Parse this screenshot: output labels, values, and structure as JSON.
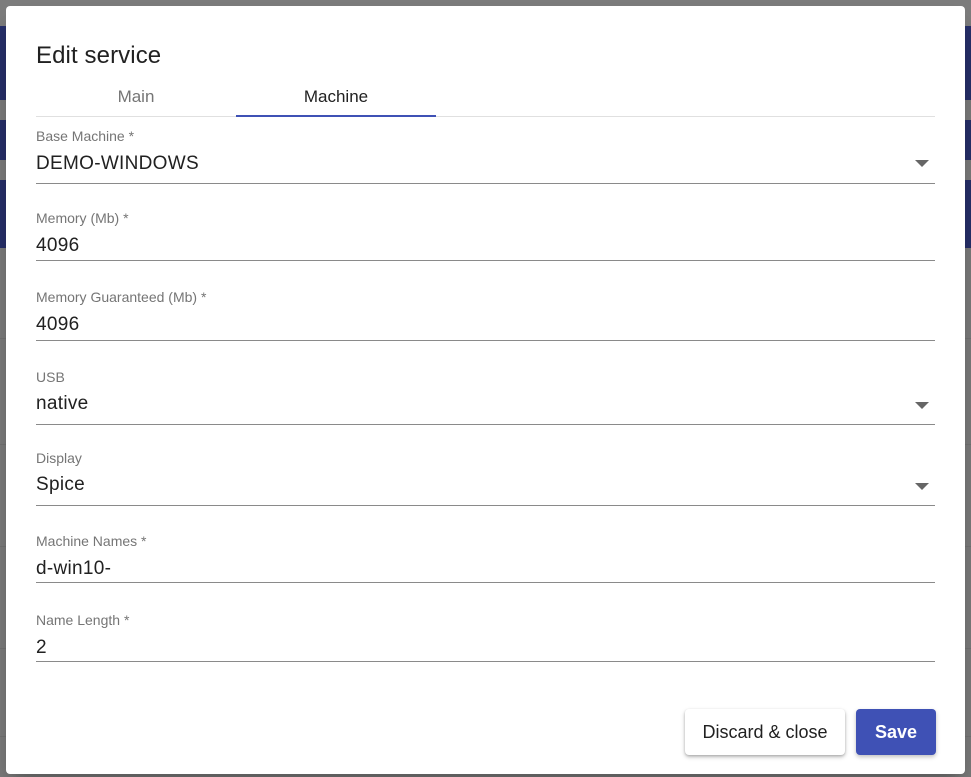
{
  "dialog": {
    "title": "Edit service",
    "tabs": [
      {
        "label": "Main",
        "active": false
      },
      {
        "label": "Machine",
        "active": true
      }
    ],
    "fields": [
      {
        "label": "Base Machine *",
        "value": "DEMO-WINDOWS",
        "type": "select"
      },
      {
        "label": "Memory (Mb) *",
        "value": "4096",
        "type": "input"
      },
      {
        "label": "Memory Guaranteed (Mb) *",
        "value": "4096",
        "type": "input"
      },
      {
        "label": "USB",
        "value": "native",
        "type": "select"
      },
      {
        "label": "Display",
        "value": "Spice",
        "type": "select"
      },
      {
        "label": "Machine Names *",
        "value": "d-win10-",
        "type": "input"
      },
      {
        "label": "Name Length *",
        "value": "2",
        "type": "input"
      }
    ],
    "buttons": {
      "discard_label": "Discard & close",
      "save_label": "Save"
    }
  },
  "colors": {
    "accent": "#3f51b5",
    "backdrop": "#7f7f7f"
  }
}
